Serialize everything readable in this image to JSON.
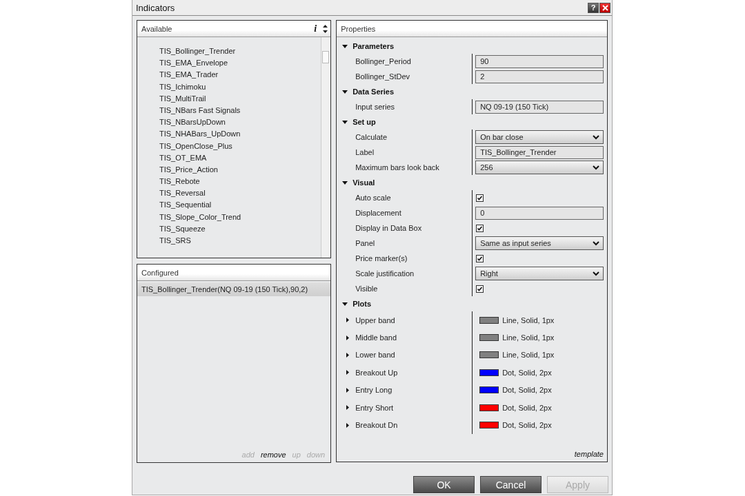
{
  "window": {
    "title": "Indicators",
    "help_button": "?"
  },
  "available": {
    "title": "Available",
    "info_icon": "i",
    "items": [
      {
        "label": "TIS_Bollinger_Trender",
        "selected": false
      },
      {
        "label": "TIS_EMA_Envelope",
        "selected": false
      },
      {
        "label": "TIS_EMA_Trader",
        "selected": false
      },
      {
        "label": "TIS_Ichimoku",
        "selected": false
      },
      {
        "label": "TIS_MultiTrail",
        "selected": false
      },
      {
        "label": "TIS_NBars Fast Signals",
        "selected": false
      },
      {
        "label": "TIS_NBarsUpDown",
        "selected": false
      },
      {
        "label": "TIS_NHABars_UpDown",
        "selected": false
      },
      {
        "label": "TIS_OpenClose_Plus",
        "selected": false
      },
      {
        "label": "TIS_OT_EMA",
        "selected": false
      },
      {
        "label": "TIS_Price_Action",
        "selected": false
      },
      {
        "label": "TIS_Rebote",
        "selected": false
      },
      {
        "label": "TIS_Reversal",
        "selected": false
      },
      {
        "label": "TIS_Sequential",
        "selected": false
      },
      {
        "label": "TIS_Slope_Color_Trend",
        "selected": false
      },
      {
        "label": "TIS_Squeeze",
        "selected": false
      },
      {
        "label": "TIS_SRS",
        "selected": false
      }
    ]
  },
  "configured": {
    "title": "Configured",
    "items": [
      {
        "label": "TIS_Bollinger_Trender(NQ 09-19 (150 Tick),90,2)",
        "selected": true
      }
    ],
    "actions": [
      {
        "label": "add",
        "disabled": true
      },
      {
        "label": "remove",
        "disabled": false
      },
      {
        "label": "up",
        "disabled": true
      },
      {
        "label": "down",
        "disabled": true
      }
    ]
  },
  "properties": {
    "title": "Properties",
    "categories": [
      {
        "name": "Parameters",
        "expanded": true,
        "rows": [
          {
            "kind": "field",
            "label": "Bollinger_Period",
            "value": "90"
          },
          {
            "kind": "field",
            "label": "Bollinger_StDev",
            "value": "2"
          }
        ]
      },
      {
        "name": "Data Series",
        "expanded": true,
        "rows": [
          {
            "kind": "field",
            "label": "Input series",
            "value": "NQ 09-19 (150 Tick)"
          }
        ]
      },
      {
        "name": "Set up",
        "expanded": true,
        "rows": [
          {
            "kind": "dropdown",
            "label": "Calculate",
            "value": "On bar close"
          },
          {
            "kind": "field",
            "label": "Label",
            "value": "TIS_Bollinger_Trender"
          },
          {
            "kind": "dropdown",
            "label": "Maximum bars look back",
            "value": "256"
          }
        ]
      },
      {
        "name": "Visual",
        "expanded": true,
        "rows": [
          {
            "kind": "checkbox",
            "label": "Auto scale",
            "checked": true
          },
          {
            "kind": "field",
            "label": "Displacement",
            "value": "0"
          },
          {
            "kind": "checkbox",
            "label": "Display in Data Box",
            "checked": true
          },
          {
            "kind": "dropdown",
            "label": "Panel",
            "value": "Same as input series"
          },
          {
            "kind": "checkbox",
            "label": "Price marker(s)",
            "checked": true
          },
          {
            "kind": "dropdown",
            "label": "Scale justification",
            "value": "Right"
          },
          {
            "kind": "checkbox",
            "label": "Visible",
            "checked": true
          }
        ]
      },
      {
        "name": "Plots",
        "expanded": true,
        "rows": [
          {
            "kind": "plot",
            "label": "Upper band",
            "expanded": false,
            "color": "#808080",
            "value": "Line, Solid, 1px"
          },
          {
            "kind": "plot",
            "label": "Middle band",
            "expanded": false,
            "color": "#808080",
            "value": "Line, Solid, 1px"
          },
          {
            "kind": "plot",
            "label": "Lower band",
            "expanded": false,
            "color": "#808080",
            "value": "Line, Solid, 1px"
          },
          {
            "kind": "plot",
            "label": "Breakout Up",
            "expanded": false,
            "color": "#0000ff",
            "value": "Dot, Solid, 2px"
          },
          {
            "kind": "plot",
            "label": "Entry Long",
            "expanded": false,
            "color": "#0000ff",
            "value": "Dot, Solid, 2px"
          },
          {
            "kind": "plot",
            "label": "Entry Short",
            "expanded": false,
            "color": "#ff0000",
            "value": "Dot, Solid, 2px"
          },
          {
            "kind": "plot",
            "label": "Breakout Dn",
            "expanded": false,
            "color": "#ff0000",
            "value": "Dot, Solid, 2px"
          }
        ]
      }
    ],
    "template_link": "template"
  },
  "buttons": [
    {
      "label": "OK",
      "disabled": false
    },
    {
      "label": "Cancel",
      "disabled": false
    },
    {
      "label": "Apply",
      "disabled": true
    }
  ]
}
